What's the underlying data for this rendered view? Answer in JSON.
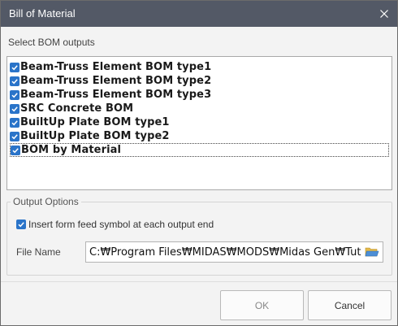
{
  "window": {
    "title": "Bill of Material"
  },
  "bom_outputs": {
    "label": "Select BOM outputs",
    "items": [
      {
        "label": "Beam-Truss Element BOM type1",
        "checked": true
      },
      {
        "label": "Beam-Truss Element BOM type2",
        "checked": true
      },
      {
        "label": "Beam-Truss Element BOM type3",
        "checked": true
      },
      {
        "label": "SRC Concrete BOM",
        "checked": true
      },
      {
        "label": "BuiltUp Plate BOM type1",
        "checked": true
      },
      {
        "label": "BuiltUp Plate BOM type2",
        "checked": true
      },
      {
        "label": "BOM by Material",
        "checked": true
      }
    ]
  },
  "output_options": {
    "title": "Output Options",
    "form_feed_label": "Insert form feed symbol at each output end",
    "form_feed_checked": true,
    "file_name_label": "File Name",
    "file_name_value": "C:₩Program Files₩MIDAS₩MODS₩Midas Gen₩Tutoria"
  },
  "buttons": {
    "ok": "OK",
    "cancel": "Cancel"
  },
  "colors": {
    "titlebar": "#535966",
    "checkbox": "#2a74c9"
  },
  "icons": {
    "close": "close-icon",
    "check": "checkmark-icon",
    "folder": "folder-open-icon"
  }
}
